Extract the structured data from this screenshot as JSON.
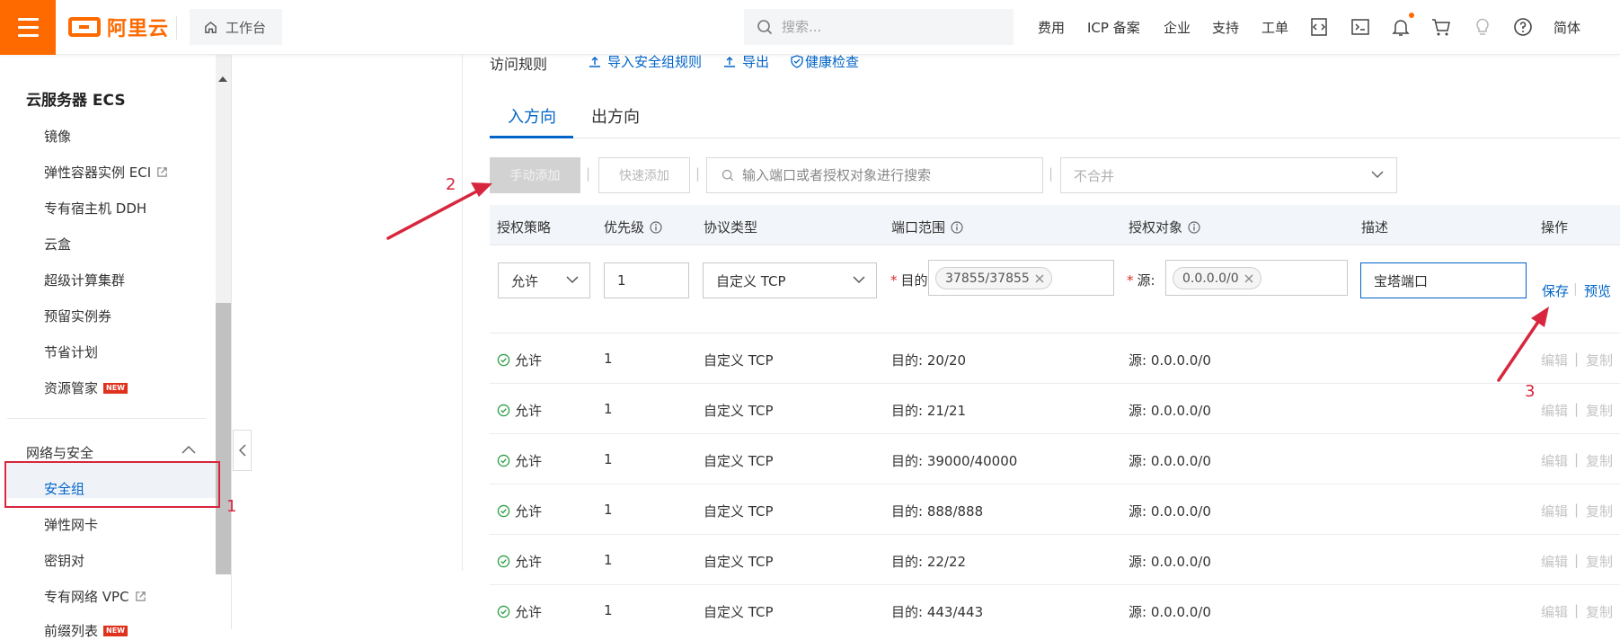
{
  "header": {
    "logo_text": "阿里云",
    "workbench_label": "工作台",
    "search_placeholder": "搜索...",
    "nav": [
      "费用",
      "ICP 备案",
      "企业",
      "支持",
      "工单"
    ],
    "language_label": "简体",
    "brand_color": "#ff6a00",
    "icons": [
      "code-icon",
      "terminal-icon",
      "bell-icon",
      "cart-icon",
      "lightbulb-icon",
      "help-icon"
    ]
  },
  "sidebar": {
    "title": "云服务器 ECS",
    "items": [
      {
        "label": "镜像"
      },
      {
        "label": "弹性容器实例 ECI",
        "external": true
      },
      {
        "label": "专有宿主机 DDH"
      },
      {
        "label": "云盒"
      },
      {
        "label": "超级计算集群"
      },
      {
        "label": "预留实例券"
      },
      {
        "label": "节省计划"
      },
      {
        "label": "资源管家",
        "badge": "NEW"
      }
    ],
    "group_label": "网络与安全",
    "group_items": [
      {
        "label": "安全组",
        "active": true
      },
      {
        "label": "弹性网卡"
      },
      {
        "label": "密钥对"
      },
      {
        "label": "专有网络 VPC",
        "external": true
      },
      {
        "label": "前缀列表",
        "badge": "NEW"
      }
    ]
  },
  "main": {
    "section_title": "访问规则",
    "links": {
      "import": "导入安全组规则",
      "export": "导出",
      "health": "健康检查"
    },
    "tabs": [
      {
        "label": "入方向",
        "active": true
      },
      {
        "label": "出方向",
        "active": false
      }
    ],
    "toolbar": {
      "manual_add": "手动添加",
      "quick_add": "快速添加",
      "search_placeholder": "输入端口或者授权对象进行搜索",
      "merge_placeholder": "不合并",
      "separator": "|"
    },
    "columns": [
      "授权策略",
      "优先级",
      "协议类型",
      "端口范围",
      "授权对象",
      "描述",
      "操作"
    ],
    "edit_row": {
      "policy": "允许",
      "priority": "1",
      "protocol": "自定义 TCP",
      "port_label": "目的:",
      "port_tag": "37855/37855",
      "source_label": "源:",
      "source_tag": "0.0.0.0/0",
      "description": "宝塔端口",
      "save": "保存",
      "preview": "预览"
    },
    "rows": [
      {
        "policy": "允许",
        "priority": "1",
        "protocol": "自定义 TCP",
        "port": "目的: 20/20",
        "source": "源: 0.0.0.0/0",
        "edit": "编辑",
        "copy": "复制"
      },
      {
        "policy": "允许",
        "priority": "1",
        "protocol": "自定义 TCP",
        "port": "目的: 21/21",
        "source": "源: 0.0.0.0/0",
        "edit": "编辑",
        "copy": "复制"
      },
      {
        "policy": "允许",
        "priority": "1",
        "protocol": "自定义 TCP",
        "port": "目的: 39000/40000",
        "source": "源: 0.0.0.0/0",
        "edit": "编辑",
        "copy": "复制"
      },
      {
        "policy": "允许",
        "priority": "1",
        "protocol": "自定义 TCP",
        "port": "目的: 888/888",
        "source": "源: 0.0.0.0/0",
        "edit": "编辑",
        "copy": "复制"
      },
      {
        "policy": "允许",
        "priority": "1",
        "protocol": "自定义 TCP",
        "port": "目的: 22/22",
        "source": "源: 0.0.0.0/0",
        "edit": "编辑",
        "copy": "复制"
      },
      {
        "policy": "允许",
        "priority": "1",
        "protocol": "自定义 TCP",
        "port": "目的: 443/443",
        "source": "源: 0.0.0.0/0",
        "edit": "编辑",
        "copy": "复制"
      }
    ],
    "accent_color": "#0064c8"
  },
  "annotations": {
    "step1": "1",
    "step2": "2",
    "step3": "3",
    "color": "#d7263d"
  }
}
